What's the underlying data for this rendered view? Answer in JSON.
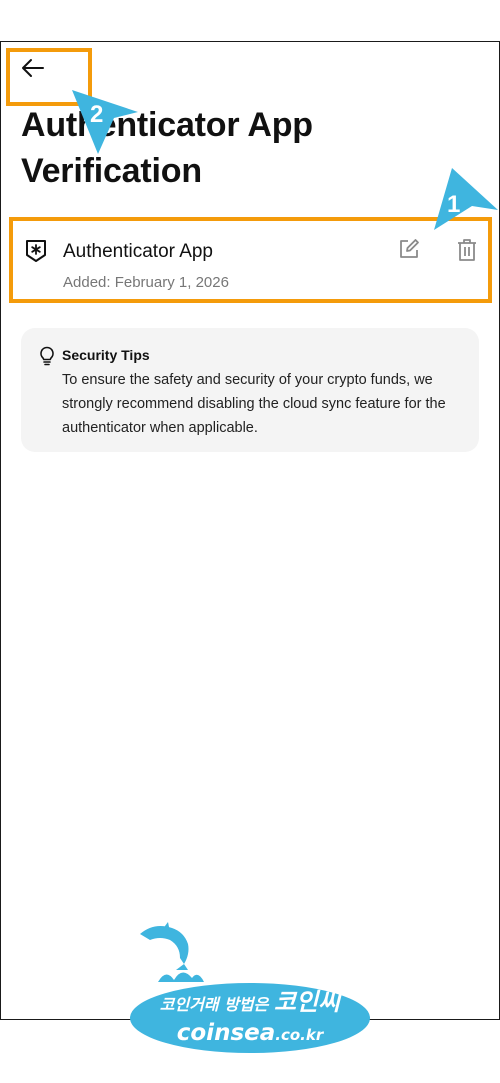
{
  "header": {
    "back_icon": "arrow-left-icon",
    "title": "Authenticator App Verification"
  },
  "authenticator": {
    "icon": "shield-asterisk-icon",
    "name": "Authenticator App",
    "added": "Added: February 1, 2026",
    "edit_icon": "edit-icon",
    "delete_icon": "trash-icon"
  },
  "security_tips": {
    "icon": "lightbulb-icon",
    "title": "Security Tips",
    "text": "To ensure the safety and security of your crypto funds, we strongly recommend disabling the cloud sync feature for the authenticator when applicable."
  },
  "annotations": {
    "highlight_color": "#f49b0b",
    "pointer_color": "#3fb5df",
    "step_1": "1",
    "step_2": "2"
  },
  "watermark": {
    "korean_prefix": "코인거래 방법은",
    "korean_brand": "코인씨",
    "url_main": "coinsea",
    "url_suffix": ".co.kr"
  }
}
